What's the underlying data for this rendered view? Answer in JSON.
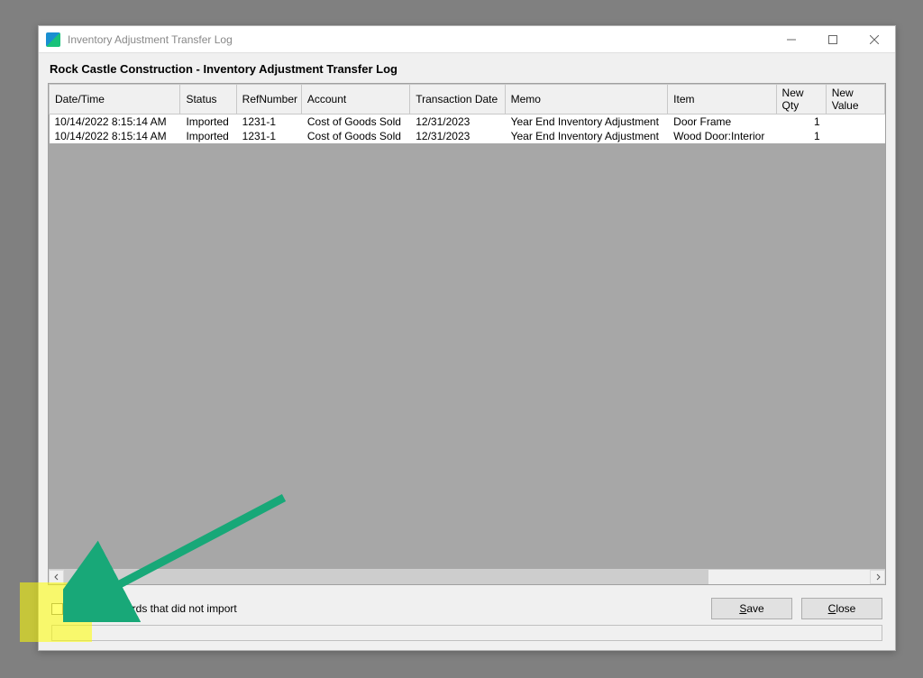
{
  "window": {
    "title": "Inventory Adjustment Transfer Log"
  },
  "heading": "Rock Castle Construction - Inventory Adjustment Transfer Log",
  "columns": {
    "datetime": "Date/Time",
    "status": "Status",
    "refnum": "RefNumber",
    "account": "Account",
    "txndate": "Transaction Date",
    "memo": "Memo",
    "item": "Item",
    "newqty": "New Qty",
    "newvalue": "New Value"
  },
  "rows": [
    {
      "datetime": "10/14/2022 8:15:14 AM",
      "status": "Imported",
      "refnum": "1231-1",
      "account": "Cost of Goods Sold",
      "txndate": "12/31/2023",
      "memo": "Year End Inventory Adjustment",
      "item": "Door Frame",
      "newqty": "1",
      "newvalue": ""
    },
    {
      "datetime": "10/14/2022 8:15:14 AM",
      "status": "Imported",
      "refnum": "1231-1",
      "account": "Cost of Goods Sold",
      "txndate": "12/31/2023",
      "memo": "Year End Inventory Adjustment",
      "item": "Wood Door:Interior",
      "newqty": "1",
      "newvalue": ""
    }
  ],
  "filter_label": "Filter for records that did not import",
  "buttons": {
    "save": "Save",
    "close": "Close"
  }
}
